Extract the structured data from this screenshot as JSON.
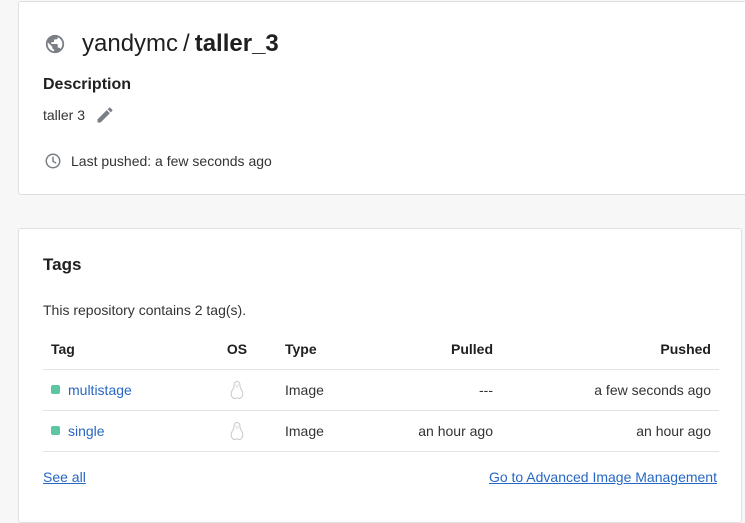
{
  "repo": {
    "namespace": "yandymc",
    "separator": "/",
    "name": "taller_3",
    "visibility_icon": "globe-icon",
    "description_label": "Description",
    "description": "taller 3",
    "last_pushed": "Last pushed: a few seconds ago"
  },
  "tags": {
    "title": "Tags",
    "count_text": "This repository contains 2 tag(s).",
    "columns": [
      "Tag",
      "OS",
      "Type",
      "Pulled",
      "Pushed"
    ],
    "rows": [
      {
        "tag": "multistage",
        "os_icon": "linux-icon",
        "type": "Image",
        "pulled": "---",
        "pushed": "a few seconds ago"
      },
      {
        "tag": "single",
        "os_icon": "linux-icon",
        "type": "Image",
        "pulled": "an hour ago",
        "pushed": "an hour ago"
      }
    ],
    "see_all": "See all",
    "advanced_link": "Go to Advanced Image Management"
  },
  "colors": {
    "link": "#2767c4",
    "status_dot": "#5cc6a3",
    "icon_gray": "#7a7f87"
  }
}
